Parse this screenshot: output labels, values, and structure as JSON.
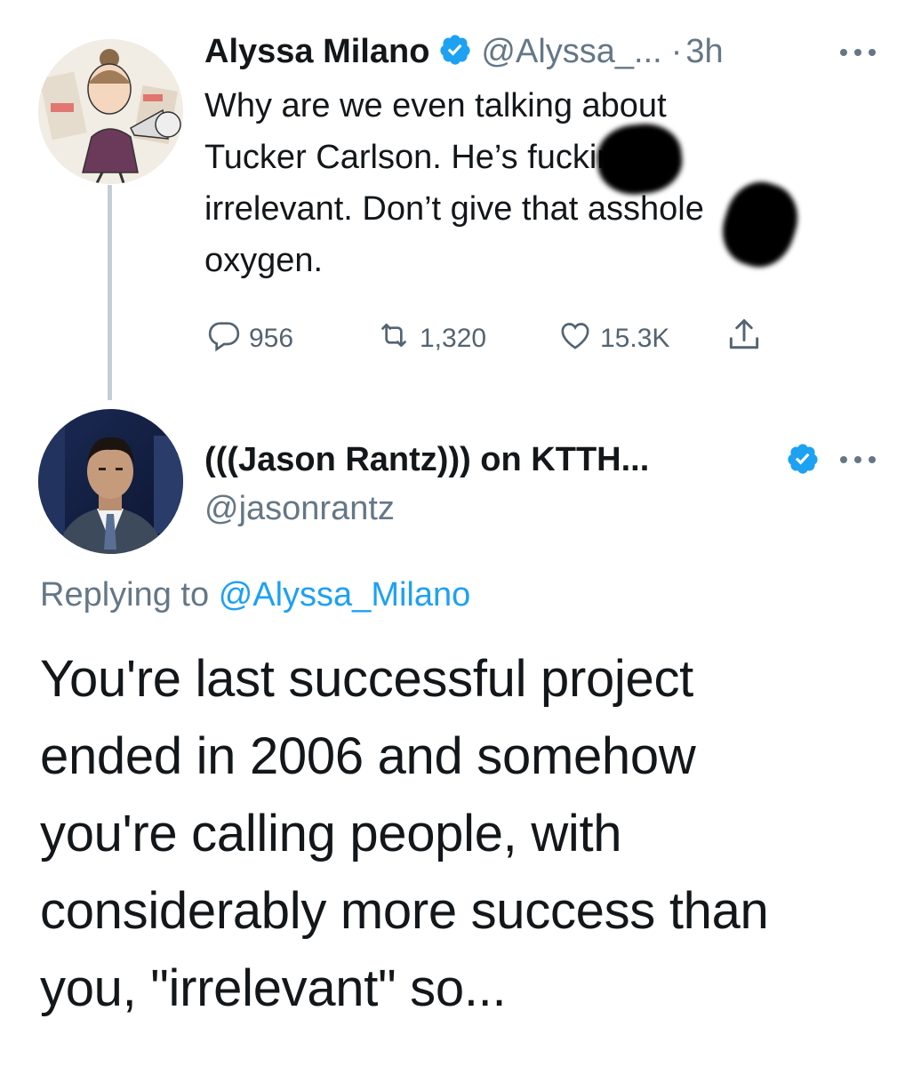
{
  "tweet1": {
    "author_name": "Alyssa Milano",
    "handle": "@Alyssa_...",
    "separator": "·",
    "time": "3h",
    "text_lines": [
      "Why are we even talking about",
      "Tucker Carlson. He’s fucking",
      "irrelevant. Don’t give that asshole",
      "oxygen."
    ],
    "actions": {
      "replies": "956",
      "retweets": "1,320",
      "likes": "15.3K"
    },
    "verified_icon": "verified-badge-icon",
    "more_icon": "more-dots-icon"
  },
  "tweet2": {
    "author_name": "(((Jason Rantz))) on KTTH...",
    "handle": "@jasonrantz",
    "replying_prefix": "Replying to",
    "replying_mention": "@Alyssa_Milano",
    "text_lines": [
      "You're last successful project",
      "ended in 2006 and somehow",
      "you're calling people, with",
      "considerably more success than",
      "you, \"irrelevant\" so..."
    ]
  },
  "colors": {
    "accent": "#1da1f2",
    "text": "#14171a",
    "secondary": "#657786",
    "thread_line": "#c4cfd6",
    "redaction": "#000000"
  }
}
